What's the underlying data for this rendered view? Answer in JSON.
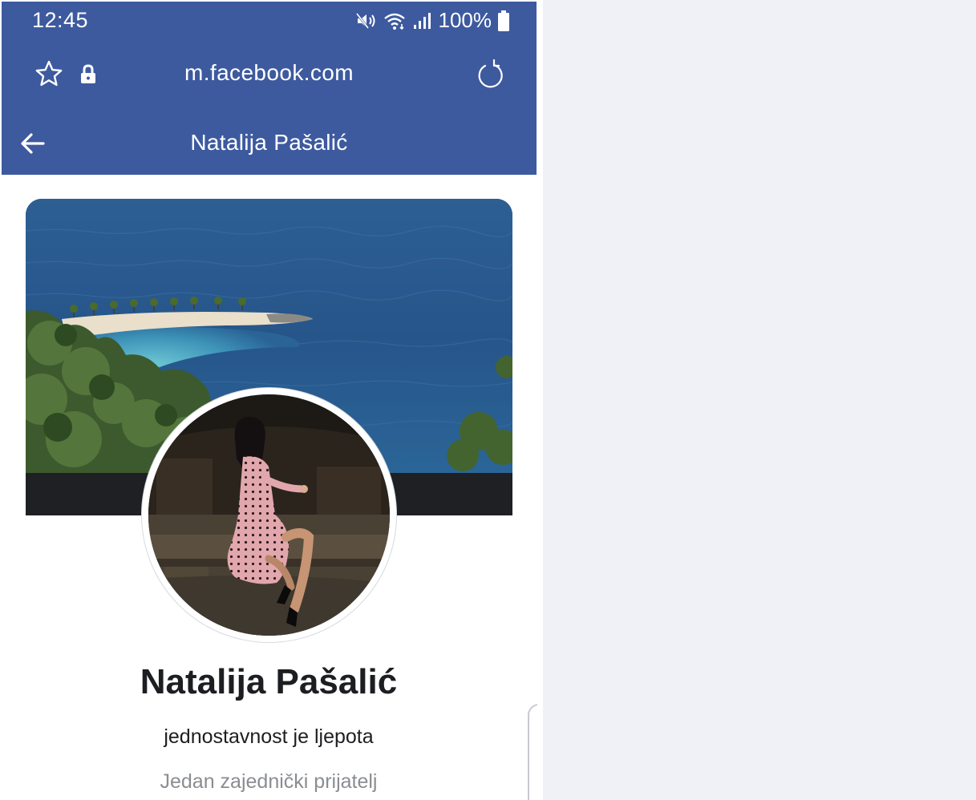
{
  "status_bar": {
    "time": "12:45",
    "battery": "100%",
    "icons": [
      "mute-icon",
      "wifi-icon",
      "signal-icon",
      "battery-icon"
    ]
  },
  "browser": {
    "url": "m.facebook.com",
    "icons": [
      "star-icon",
      "lock-icon",
      "reload-icon"
    ]
  },
  "header": {
    "title": "Natalija Pašalić",
    "back_icon": "back-arrow-icon"
  },
  "profile": {
    "name": "Natalija Pašalić",
    "bio": "jednostavnost je ljepota",
    "mutual_friends": "Jedan zajednički prijatelj"
  },
  "colors": {
    "header_bg": "#3d5a9f",
    "page_bg": "#eff1f6",
    "cover_band": "#1e2024",
    "name_text": "#1c1e21",
    "secondary_text": "#8a8d91"
  }
}
